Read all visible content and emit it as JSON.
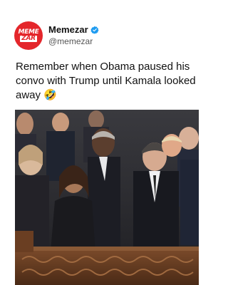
{
  "post": {
    "author": {
      "name": "Memezar",
      "handle": "@memezar",
      "verified": true,
      "avatar_logo": [
        "MEME",
        "ZAR"
      ]
    },
    "caption": "Remember when Obama paused his convo with Trump until Kamala looked away 🤣",
    "media": {
      "type": "photo",
      "icon": "photo-image"
    }
  },
  "colors": {
    "brand": "#e4262b",
    "verified": "#1d9bf0",
    "text": "#111111",
    "secondary_text": "#555555"
  }
}
